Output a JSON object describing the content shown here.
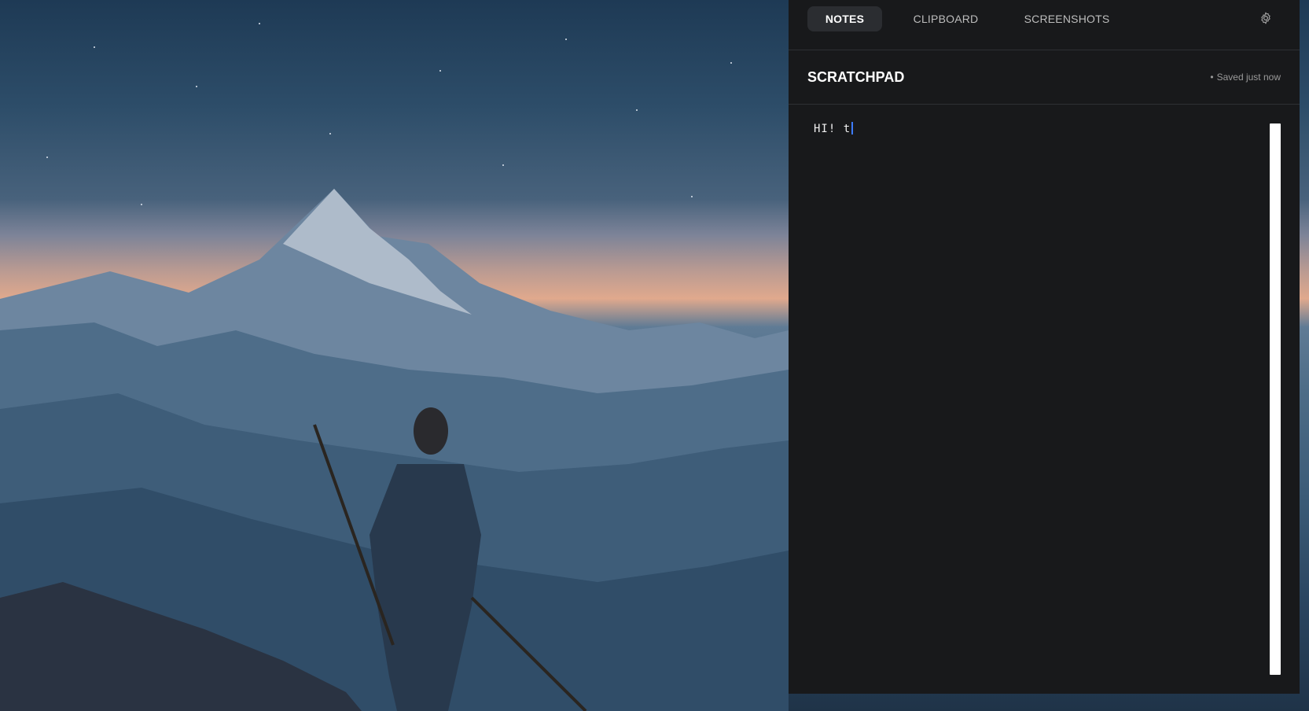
{
  "tabs": {
    "notes": "NOTES",
    "clipboard": "CLIPBOARD",
    "screenshots": "SCREENSHOTS",
    "active": "notes"
  },
  "settings": {
    "icon": "gear-icon"
  },
  "scratchpad": {
    "title": "SCRATCHPAD",
    "status_dot": "•",
    "status": "Saved just now",
    "content": "HI! t"
  },
  "colors": {
    "panel_bg": "#18191b",
    "tab_active_bg": "#2b2d31",
    "caret": "#3d7bff"
  }
}
